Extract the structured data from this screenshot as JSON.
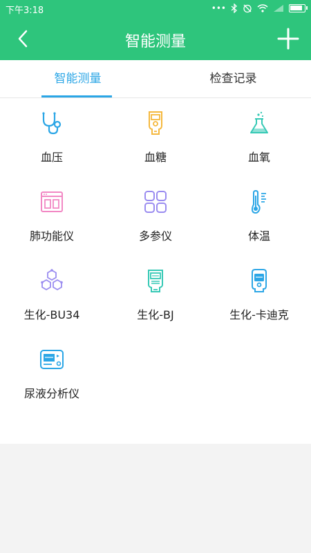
{
  "status_bar": {
    "time": "下午3:18",
    "dots": "•••"
  },
  "header": {
    "title": "智能测量"
  },
  "tabs": [
    {
      "label": "智能测量",
      "active": true
    },
    {
      "label": "检查记录",
      "active": false
    }
  ],
  "items": [
    {
      "label": "血压",
      "icon": "stethoscope-icon",
      "color": "#2ba6e6"
    },
    {
      "label": "血糖",
      "icon": "glucose-meter-icon",
      "color": "#f5b83d"
    },
    {
      "label": "血氧",
      "icon": "flask-icon",
      "color": "#35c9b5"
    },
    {
      "label": "肺功能仪",
      "icon": "lung-function-icon",
      "color": "#f288c4"
    },
    {
      "label": "多参仪",
      "icon": "multi-grid-icon",
      "color": "#9a8cf0"
    },
    {
      "label": "体温",
      "icon": "thermometer-icon",
      "color": "#2ba6e6"
    },
    {
      "label": "生化-BU34",
      "icon": "molecule-icon",
      "color": "#9a8cf0"
    },
    {
      "label": "生化-BJ",
      "icon": "analyzer-bj-icon",
      "color": "#35c9b5"
    },
    {
      "label": "生化-卡迪克",
      "icon": "analyzer-cardiac-icon",
      "color": "#2ba6e6"
    },
    {
      "label": "尿液分析仪",
      "icon": "urine-analyzer-icon",
      "color": "#2ba6e6"
    }
  ],
  "colors": {
    "primary": "#2ec57c",
    "accent": "#2ba6e6",
    "background": "#f3f3f3"
  }
}
